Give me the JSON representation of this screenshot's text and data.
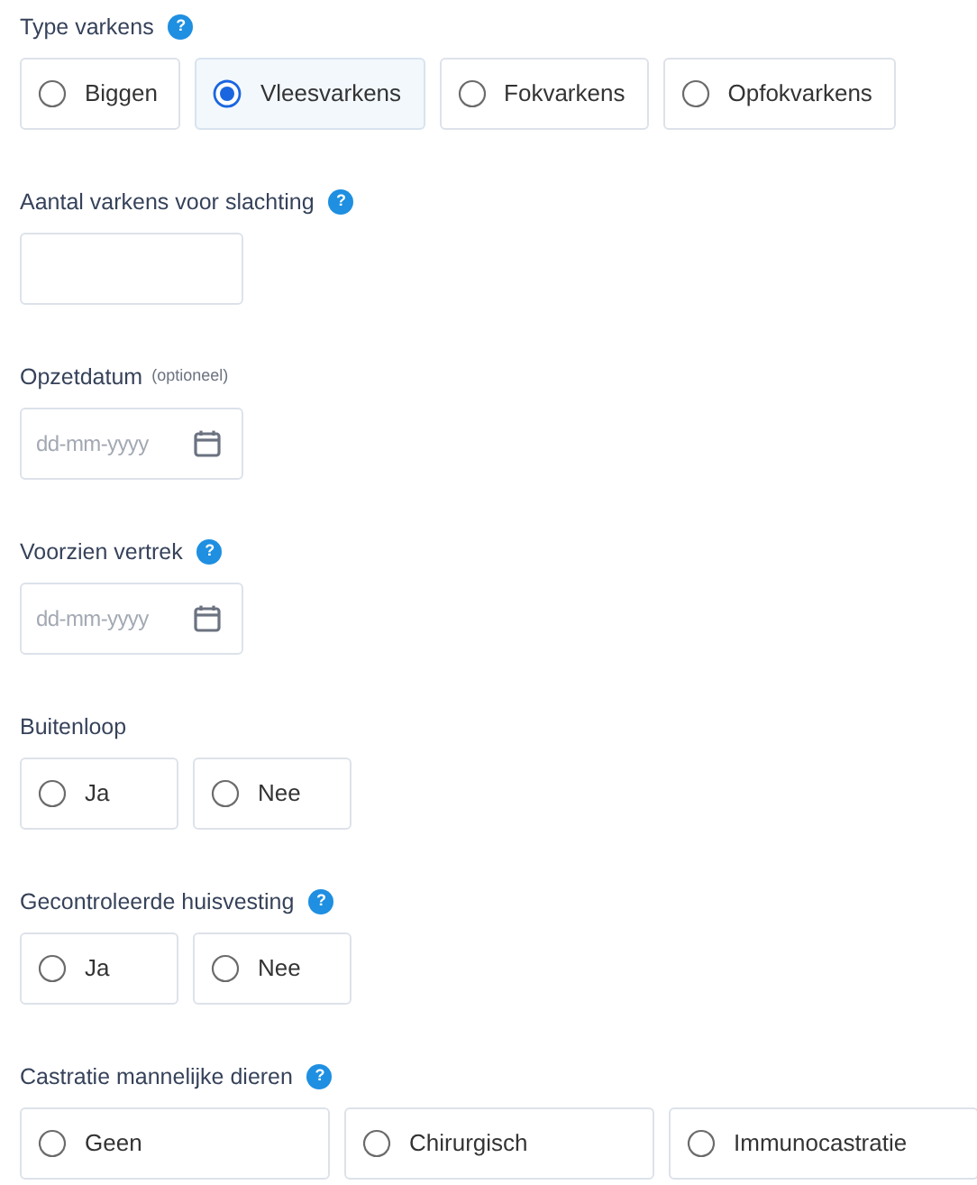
{
  "fields": [
    {
      "kind": "radio",
      "label": "Type varkens",
      "help": "?",
      "options": [
        {
          "label": "Biggen",
          "selected": false
        },
        {
          "label": "Vleesvarkens",
          "selected": true
        },
        {
          "label": "Fokvarkens",
          "selected": false
        },
        {
          "label": "Opfokvarkens",
          "selected": false
        }
      ]
    },
    {
      "kind": "number",
      "label": "Aantal varkens voor slachting",
      "help": "?"
    },
    {
      "kind": "date",
      "label": "Opzetdatum",
      "note": "(optioneel)",
      "placeholder": "dd-mm-yyyy"
    },
    {
      "kind": "date",
      "label": "Voorzien vertrek",
      "help": "?",
      "placeholder": "dd-mm-yyyy"
    },
    {
      "kind": "radio",
      "label": "Buitenloop",
      "options": [
        {
          "label": "Ja",
          "selected": false
        },
        {
          "label": "Nee",
          "selected": false
        }
      ]
    },
    {
      "kind": "radio",
      "label": "Gecontroleerde huisvesting",
      "help": "?",
      "options": [
        {
          "label": "Ja",
          "selected": false
        },
        {
          "label": "Nee",
          "selected": false
        }
      ]
    },
    {
      "kind": "radio",
      "label": "Castratie mannelijke dieren",
      "help": "?",
      "options": [
        {
          "label": "Geen",
          "selected": false
        },
        {
          "label": "Chirurgisch",
          "selected": false
        },
        {
          "label": "Immunocastratie",
          "selected": false
        }
      ]
    }
  ]
}
